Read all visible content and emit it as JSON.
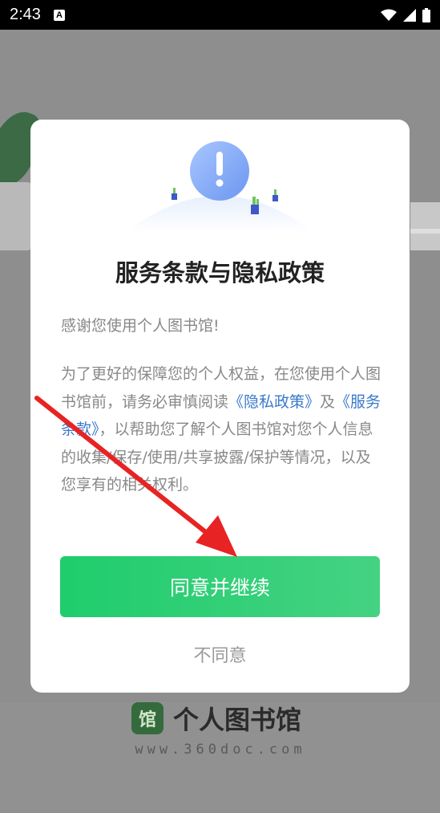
{
  "status_bar": {
    "time": "2:43",
    "notification_icon": "a-letter-icon",
    "icons": [
      "wifi-icon",
      "signal-icon",
      "battery-icon"
    ]
  },
  "dialog": {
    "title": "服务条款与隐私政策",
    "greeting": "感谢您使用个人图书馆!",
    "body_before_privacy": "为了更好的保障您的个人权益，在您使用个人图书馆前，请务必审慎阅读",
    "privacy_link": "《隐私政策》",
    "conjunction": "及",
    "terms_link": "《服务条款》",
    "body_after_terms": "，以帮助您了解个人图书馆对您个人信息的收集/保存/使用/共享披露/保护等情况，以及您享有的相关权利。",
    "agree_button": "同意并继续",
    "disagree_button": "不同意",
    "illustration_icon": "exclamation-icon"
  },
  "brand": {
    "logo_glyph": "馆",
    "name": "个人图书馆",
    "url": "www.360doc.com"
  },
  "colors": {
    "accent_green": "#1fcd6c",
    "link_blue": "#3a79c9",
    "annotation_red": "#e82323"
  }
}
